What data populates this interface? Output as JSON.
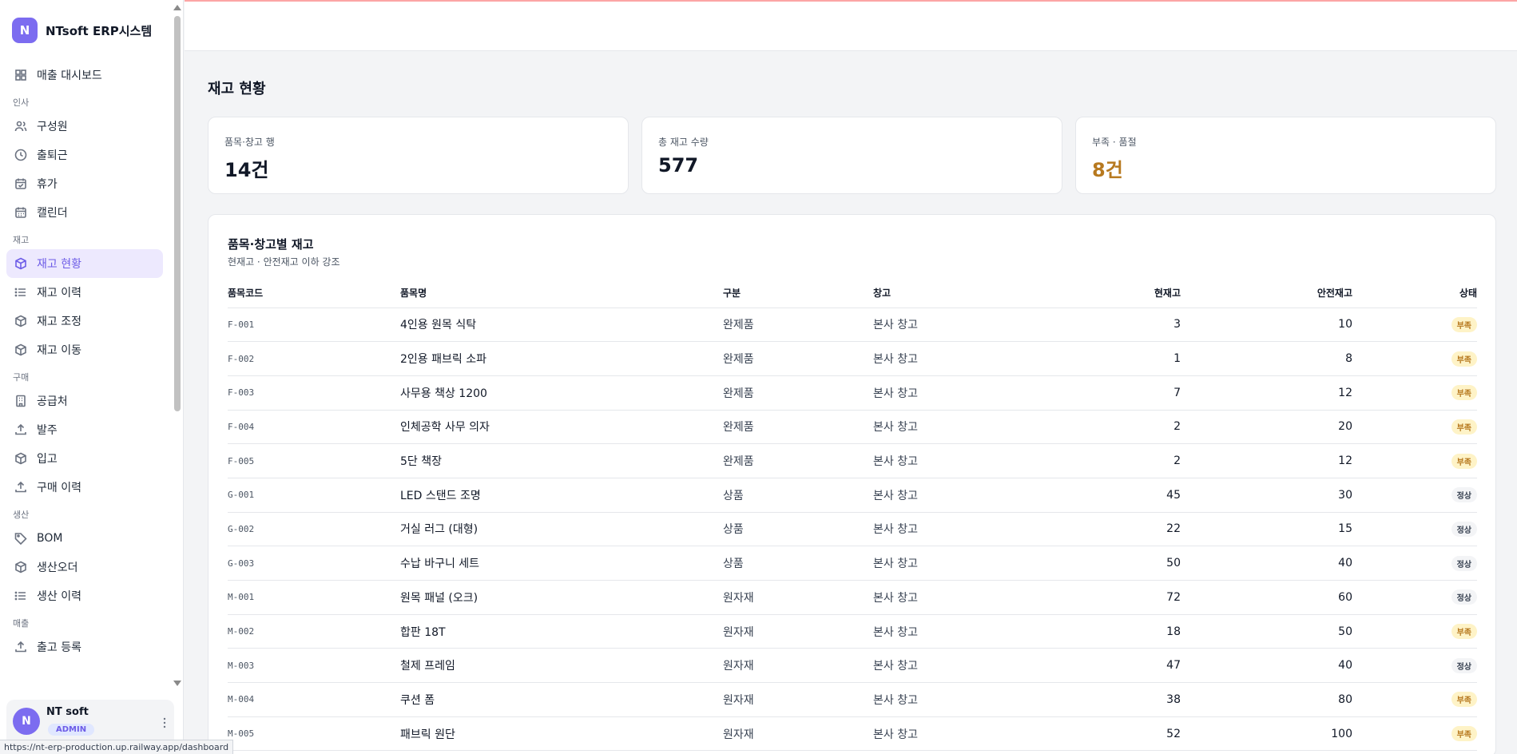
{
  "brand": {
    "logo_letter": "N",
    "name": "NTsoft ERP시스템"
  },
  "sidebar": {
    "dashboard": {
      "label": "매출 대시보드",
      "icon": "grid-icon"
    },
    "sections": [
      {
        "title": "인사",
        "items": [
          {
            "label": "구성원",
            "icon": "users-icon"
          },
          {
            "label": "출퇴근",
            "icon": "clock-icon"
          },
          {
            "label": "휴가",
            "icon": "calendar-check-icon"
          },
          {
            "label": "캘린더",
            "icon": "calendar-icon"
          }
        ]
      },
      {
        "title": "재고",
        "items": [
          {
            "label": "재고 현황",
            "icon": "box-icon",
            "active": true
          },
          {
            "label": "재고 이력",
            "icon": "list-icon"
          },
          {
            "label": "재고 조정",
            "icon": "box-icon"
          },
          {
            "label": "재고 이동",
            "icon": "box-icon"
          }
        ]
      },
      {
        "title": "구매",
        "items": [
          {
            "label": "공급처",
            "icon": "building-icon"
          },
          {
            "label": "발주",
            "icon": "upload-icon"
          },
          {
            "label": "입고",
            "icon": "box-icon"
          },
          {
            "label": "구매 이력",
            "icon": "upload-icon"
          }
        ]
      },
      {
        "title": "생산",
        "items": [
          {
            "label": "BOM",
            "icon": "tag-icon"
          },
          {
            "label": "생산오더",
            "icon": "box-icon"
          },
          {
            "label": "생산 이력",
            "icon": "list-icon"
          }
        ]
      },
      {
        "title": "매출",
        "items": [
          {
            "label": "출고 등록",
            "icon": "upload-icon"
          }
        ]
      }
    ]
  },
  "user": {
    "avatar_letter": "N",
    "name": "NT soft",
    "role": "ADMIN"
  },
  "page": {
    "title": "재고 현황"
  },
  "stats": [
    {
      "label": "품목·창고 행",
      "value": "14건"
    },
    {
      "label": "총 재고 수량",
      "value": "577"
    },
    {
      "label": "부족 · 품절",
      "value": "8건"
    }
  ],
  "table": {
    "title": "품목·창고별 재고",
    "subtitle": "현재고 · 안전재고 이하 강조",
    "headers": [
      "품목코드",
      "품목명",
      "구분",
      "창고",
      "현재고",
      "안전재고",
      "상태"
    ],
    "rows": [
      {
        "code": "F-001",
        "name": "4인용 원목 식탁",
        "cat": "완제품",
        "wh": "본사 창고",
        "qty": "3",
        "safety": "10",
        "status": "부족"
      },
      {
        "code": "F-002",
        "name": "2인용 패브릭 소파",
        "cat": "완제품",
        "wh": "본사 창고",
        "qty": "1",
        "safety": "8",
        "status": "부족"
      },
      {
        "code": "F-003",
        "name": "사무용 책상 1200",
        "cat": "완제품",
        "wh": "본사 창고",
        "qty": "7",
        "safety": "12",
        "status": "부족"
      },
      {
        "code": "F-004",
        "name": "인체공학 사무 의자",
        "cat": "완제품",
        "wh": "본사 창고",
        "qty": "2",
        "safety": "20",
        "status": "부족"
      },
      {
        "code": "F-005",
        "name": "5단 책장",
        "cat": "완제품",
        "wh": "본사 창고",
        "qty": "2",
        "safety": "12",
        "status": "부족"
      },
      {
        "code": "G-001",
        "name": "LED 스탠드 조명",
        "cat": "상품",
        "wh": "본사 창고",
        "qty": "45",
        "safety": "30",
        "status": "정상"
      },
      {
        "code": "G-002",
        "name": "거실 러그 (대형)",
        "cat": "상품",
        "wh": "본사 창고",
        "qty": "22",
        "safety": "15",
        "status": "정상"
      },
      {
        "code": "G-003",
        "name": "수납 바구니 세트",
        "cat": "상품",
        "wh": "본사 창고",
        "qty": "50",
        "safety": "40",
        "status": "정상"
      },
      {
        "code": "M-001",
        "name": "원목 패널 (오크)",
        "cat": "원자재",
        "wh": "본사 창고",
        "qty": "72",
        "safety": "60",
        "status": "정상"
      },
      {
        "code": "M-002",
        "name": "합판 18T",
        "cat": "원자재",
        "wh": "본사 창고",
        "qty": "18",
        "safety": "50",
        "status": "부족"
      },
      {
        "code": "M-003",
        "name": "철제 프레임",
        "cat": "원자재",
        "wh": "본사 창고",
        "qty": "47",
        "safety": "40",
        "status": "정상"
      },
      {
        "code": "M-004",
        "name": "쿠션 폼",
        "cat": "원자재",
        "wh": "본사 창고",
        "qty": "38",
        "safety": "80",
        "status": "부족"
      },
      {
        "code": "M-005",
        "name": "패브릭 원단",
        "cat": "원자재",
        "wh": "본사 창고",
        "qty": "52",
        "safety": "100",
        "status": "부족"
      }
    ]
  },
  "statusbar": {
    "url": "https://nt-erp-production.up.railway.app/dashboard"
  }
}
